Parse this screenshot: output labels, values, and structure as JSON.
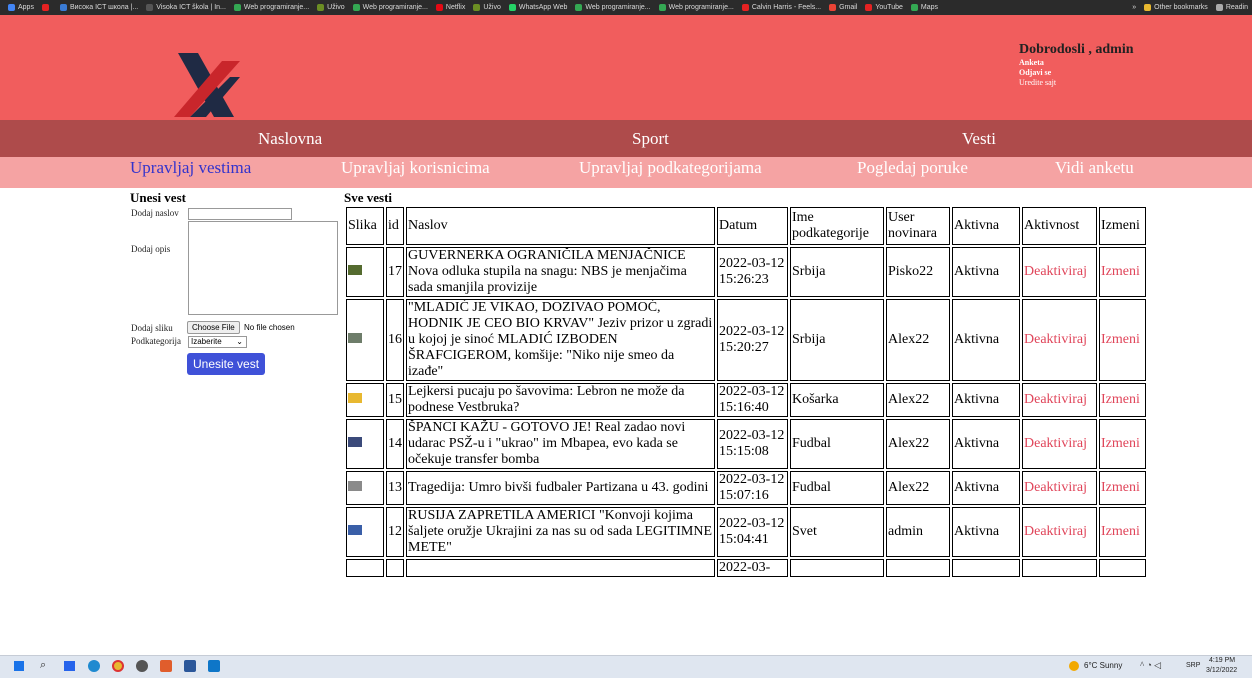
{
  "bookmarks": [
    {
      "label": "Apps",
      "color": "#4285f4"
    },
    {
      "label": "",
      "color": "#e52222"
    },
    {
      "label": "Висока ICT школа |...",
      "color": "#3a7bd5"
    },
    {
      "label": "Visoka ICT škola | In...",
      "color": "#555555"
    },
    {
      "label": "Web programiranje...",
      "color": "#34a853"
    },
    {
      "label": "Uživo",
      "color": "#6b8e23"
    },
    {
      "label": "Web programiranje...",
      "color": "#34a853"
    },
    {
      "label": "Netflix",
      "color": "#e50914"
    },
    {
      "label": "Uživo",
      "color": "#6b8e23"
    },
    {
      "label": "WhatsApp Web",
      "color": "#25d366"
    },
    {
      "label": "Web programiranje...",
      "color": "#34a853"
    },
    {
      "label": "Web programiranje...",
      "color": "#34a853"
    },
    {
      "label": "Calvin Harris - Feels...",
      "color": "#e52222"
    },
    {
      "label": "Gmail",
      "color": "#ea4335"
    },
    {
      "label": "YouTube",
      "color": "#e52222"
    },
    {
      "label": "Maps",
      "color": "#34a853"
    }
  ],
  "bookmarks_right": {
    "more": "»",
    "other": "Other bookmarks",
    "reading": "Readin"
  },
  "header": {
    "welcome": "Dobrodosli , admin",
    "links": [
      "Anketa",
      "Odjavi se",
      "Uredite sajt"
    ]
  },
  "nav": [
    "Naslovna",
    "Sport",
    "Vesti"
  ],
  "subnav": [
    "Upravljaj vestima",
    "Upravljaj korisnicima",
    "Upravljaj podkategorijama",
    "Pogledaj poruke",
    "Vidi anketu"
  ],
  "form": {
    "title": "Unesi vest",
    "naslov_label": "Dodaj naslov",
    "opis_label": "Dodaj opis",
    "slika_label": "Dodaj sliku",
    "file_button": "Choose File",
    "file_status": "No file chosen",
    "podkat_label": "Podkategorija",
    "podkat_value": "Izaberite",
    "submit": "Unesite vest"
  },
  "table": {
    "title": "Sve vesti",
    "headers": [
      "Slika",
      "id",
      "Naslov",
      "Datum",
      "Ime podkategorije",
      "User novinara",
      "Aktivna",
      "Aktivnost",
      "Izmeni"
    ],
    "rows": [
      {
        "thumb": "#556b2f",
        "id": "17",
        "naslov": "GUVERNERKA OGRANIČILA MENJAČNICE Nova odluka stupila na snagu: NBS je menjačima sada smanjila provizije",
        "datum": "2022-03-12 15:26:23",
        "podkat": "Srbija",
        "user": "Pisko22",
        "aktivna": "Aktivna",
        "akcija": "Deaktiviraj",
        "izmeni": "Izmeni"
      },
      {
        "thumb": "#6e7d6a",
        "id": "16",
        "naslov": "\"MLADIĆ JE VIKAO, DOZIVAO POMOĆ, HODNIK JE CEO BIO KRVAV\" Jeziv prizor u zgradi u kojoj je sinoć MLADIĆ IZBODEN ŠRAFCIGEROM, komšije: \"Niko nije smeo da izađe\"",
        "datum": "2022-03-12 15:20:27",
        "podkat": "Srbija",
        "user": "Alex22",
        "aktivna": "Aktivna",
        "akcija": "Deaktiviraj",
        "izmeni": "Izmeni"
      },
      {
        "thumb": "#e8b830",
        "id": "15",
        "naslov": "Lejkersi pucaju po šavovima: Lebron ne može da podnese Vestbruka?",
        "datum": "2022-03-12 15:16:40",
        "podkat": "Košarka",
        "user": "Alex22",
        "aktivna": "Aktivna",
        "akcija": "Deaktiviraj",
        "izmeni": "Izmeni"
      },
      {
        "thumb": "#3b4a7a",
        "id": "14",
        "naslov": "ŠPANCI KAŽU - GOTOVO JE! Real zadao novi udarac PSŽ-u i \"ukrao\" im Mbapea, evo kada se očekuje transfer bomba",
        "datum": "2022-03-12 15:15:08",
        "podkat": "Fudbal",
        "user": "Alex22",
        "aktivna": "Aktivna",
        "akcija": "Deaktiviraj",
        "izmeni": "Izmeni"
      },
      {
        "thumb": "#8a8a8a",
        "id": "13",
        "naslov": "Tragedija: Umro bivši fudbaler Partizana u 43. godini",
        "datum": "2022-03-12 15:07:16",
        "podkat": "Fudbal",
        "user": "Alex22",
        "aktivna": "Aktivna",
        "akcija": "Deaktiviraj",
        "izmeni": "Izmeni"
      },
      {
        "thumb": "#3a5fa8",
        "id": "12",
        "naslov": "RUSIJA ZAPRETILA AMERICI \"Konvoji kojima šaljete oružje Ukrajini za nas su od sada LEGITIMNE METE\"",
        "datum": "2022-03-12 15:04:41",
        "podkat": "Svet",
        "user": "admin",
        "aktivna": "Aktivna",
        "akcija": "Deaktiviraj",
        "izmeni": "Izmeni"
      },
      {
        "thumb": "",
        "id": "",
        "naslov": "",
        "datum": "2022-03-",
        "podkat": "",
        "user": "",
        "aktivna": "",
        "akcija": "",
        "izmeni": ""
      }
    ]
  },
  "taskbar": {
    "weather": "6°C Sunny",
    "lang": "SRP",
    "time": "4:19 PM",
    "date": "3/12/2022"
  }
}
